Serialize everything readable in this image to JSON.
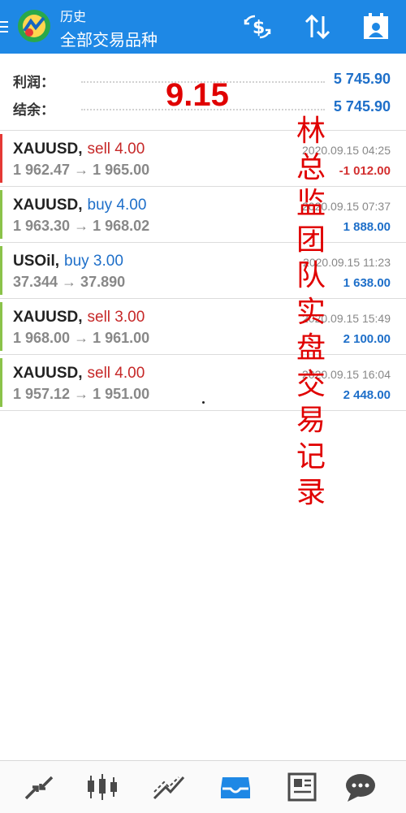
{
  "header": {
    "subtitle": "历史",
    "title": "全部交易品种",
    "icons": [
      "menu-icon",
      "metatrader-logo",
      "currency-swap-icon",
      "sort-icon",
      "calendar-icon"
    ],
    "accent": "#1e88e5"
  },
  "summary": {
    "profit_label": "利润：",
    "profit_value": "5 745.90",
    "balance_label": "结余：",
    "balance_value": "5 745.90"
  },
  "overlay_date": "9.15",
  "caption_chars": [
    "林",
    "总",
    "监",
    "团",
    "队",
    "实",
    "盘",
    "交",
    "易",
    "记",
    "录"
  ],
  "deals": [
    {
      "symbol": "XAUUSD",
      "type": "sell 4.00",
      "side": "sell",
      "prices": "1 962.47 → 1 965.00",
      "time": "2020.09.15 04:25",
      "profit": "-1 012.00",
      "result": "loss"
    },
    {
      "symbol": "XAUUSD",
      "type": "buy 4.00",
      "side": "buy",
      "prices": "1 963.30 → 1 968.02",
      "time": "2020.09.15 07:37",
      "profit": "1 888.00",
      "result": "gain"
    },
    {
      "symbol": "USOil",
      "type": "buy 3.00",
      "side": "buy",
      "prices": "37.344 → 37.890",
      "time": "2020.09.15 11:23",
      "profit": "1 638.00",
      "result": "gain"
    },
    {
      "symbol": "XAUUSD",
      "type": "sell 3.00",
      "side": "sell",
      "prices": "1 968.00 → 1 961.00",
      "time": "2020.09.15 15:49",
      "profit": "2 100.00",
      "result": "gain"
    },
    {
      "symbol": "XAUUSD",
      "type": "sell 4.00",
      "side": "sell",
      "prices": "1 957.12 → 1 951.00",
      "time": "2020.09.15 16:04",
      "profit": "2 448.00",
      "result": "gain"
    }
  ],
  "colors": {
    "sell": "#c62828",
    "buy": "#1e6fc9",
    "loss": "#d32f2f",
    "gain": "#1e6fc9",
    "loss_bar": "#e53935",
    "gain_bar": "#8bc34a",
    "nav_active": "#1e88e5",
    "nav_inactive": "#4a4a4a"
  },
  "bottom_nav": [
    {
      "icon": "quotes-arrows-icon",
      "active": false
    },
    {
      "icon": "candlestick-chart-icon",
      "active": false
    },
    {
      "icon": "trade-chart-icon",
      "active": false
    },
    {
      "icon": "history-inbox-icon",
      "active": true
    },
    {
      "icon": "news-icon",
      "active": false
    },
    {
      "icon": "chat-icon",
      "active": false
    }
  ]
}
